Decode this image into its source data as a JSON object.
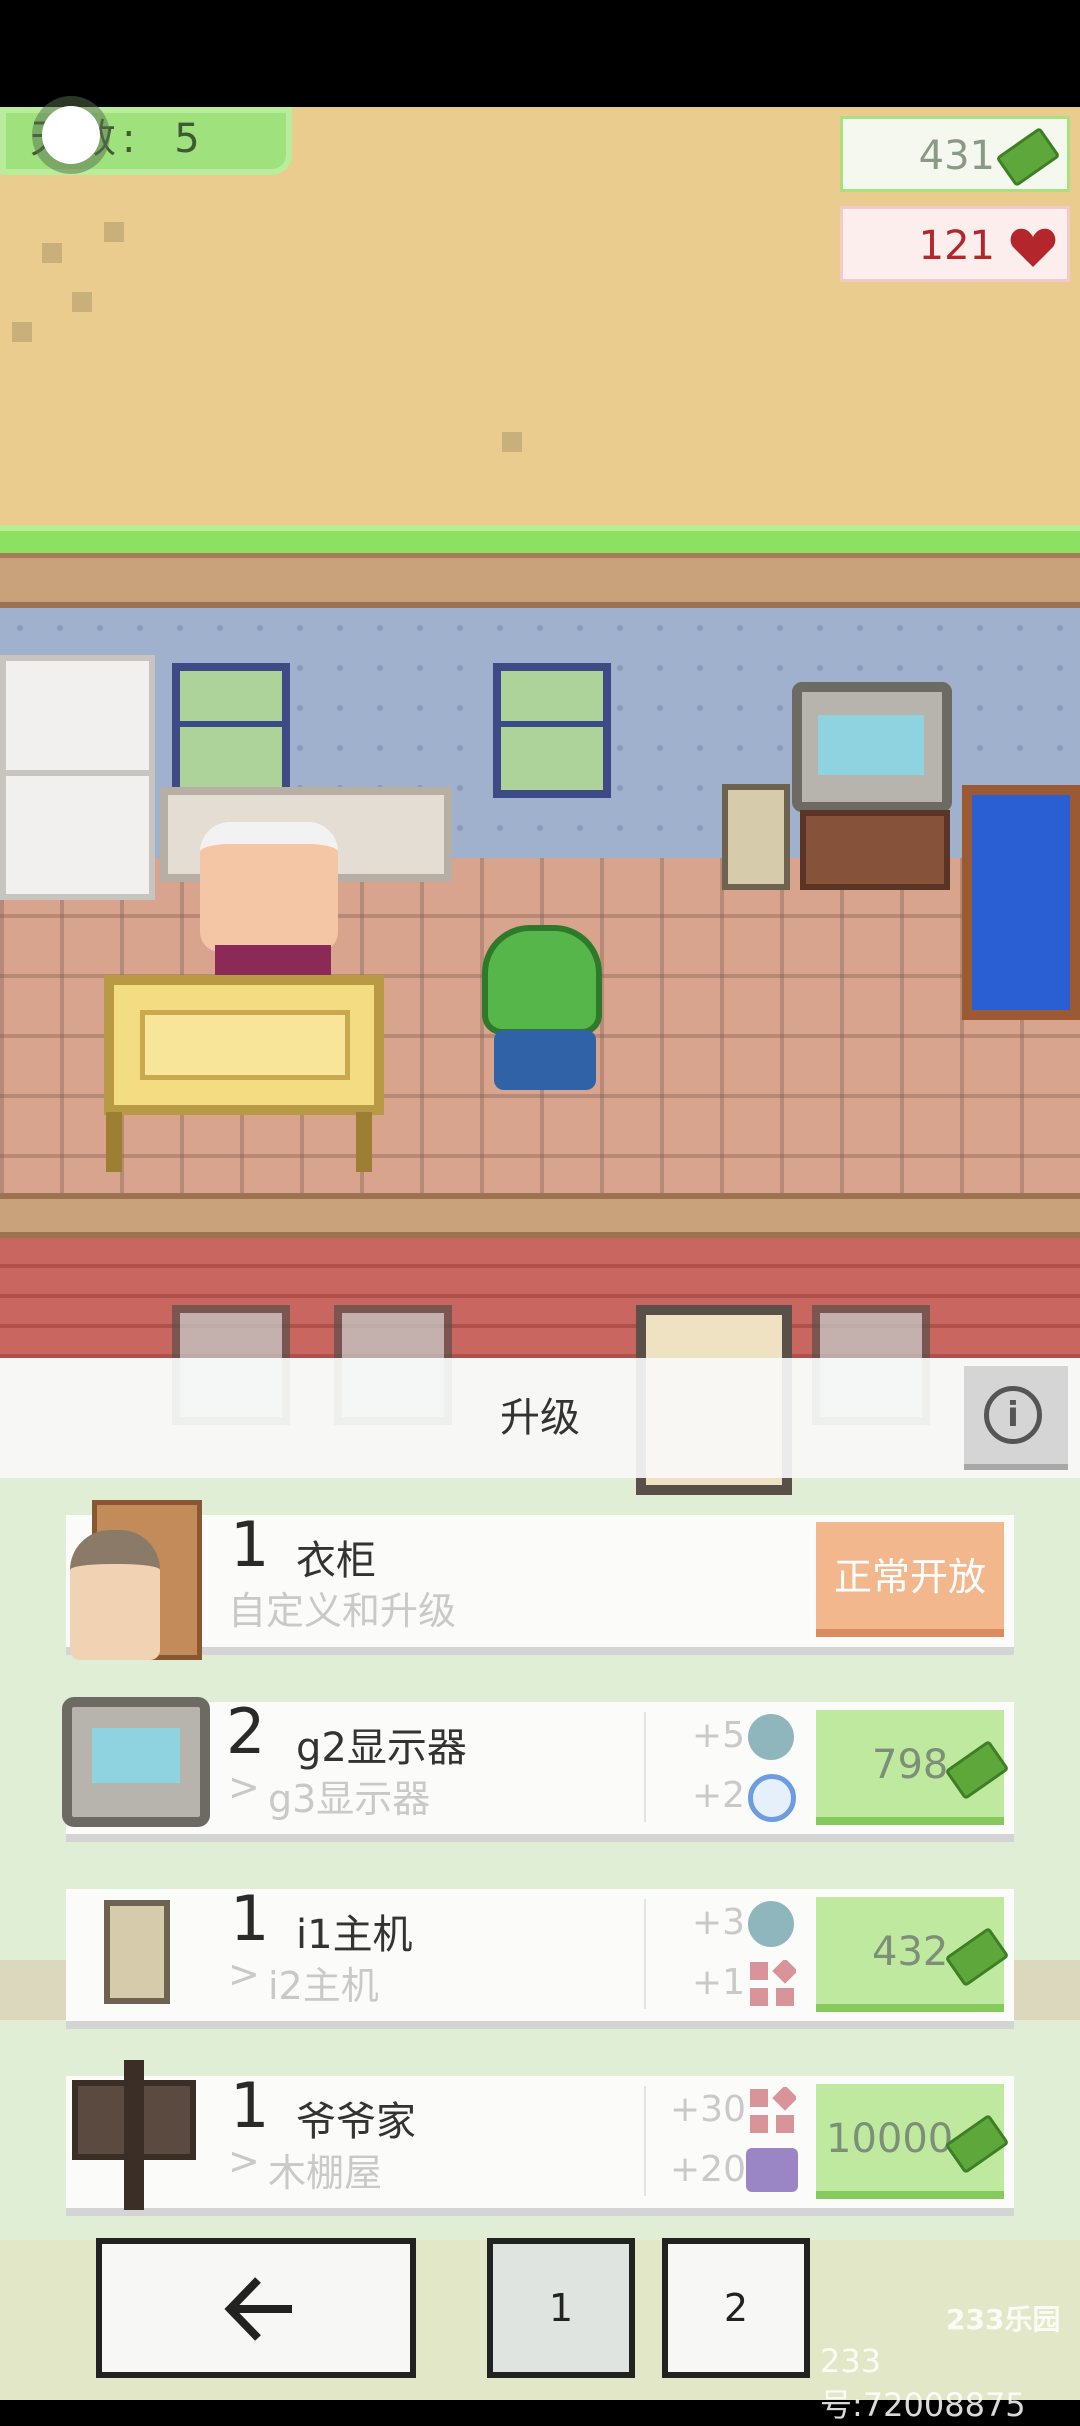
{
  "hud": {
    "day_label": "天数:",
    "day_value": "5",
    "money": "431",
    "hearts": "121"
  },
  "panel": {
    "title": "升级",
    "info_icon": "info-icon"
  },
  "cards": [
    {
      "level": "1",
      "name": "衣柜",
      "sub": "自定义和升级",
      "action_label": "正常开放"
    },
    {
      "level": "2",
      "name": "g2显示器",
      "next": "g3显示器",
      "bonus1": "+5",
      "bonus1_icon": "gear-icon",
      "bonus2": "+2",
      "bonus2_icon": "face-icon",
      "price": "798"
    },
    {
      "level": "1",
      "name": "i1主机",
      "next": "i2主机",
      "bonus1": "+3",
      "bonus1_icon": "gear-icon",
      "bonus2": "+1",
      "bonus2_icon": "blocks-icon",
      "price": "432"
    },
    {
      "level": "1",
      "name": "爷爷家",
      "next": "木棚屋",
      "bonus1": "+30",
      "bonus1_icon": "blocks-icon",
      "bonus2": "+20",
      "bonus2_icon": "chat-icon",
      "price": "10000"
    }
  ],
  "nav": {
    "back_icon": "arrow-left-icon",
    "page1": "1",
    "page2": "2"
  },
  "watermark": {
    "logo": "233乐园",
    "id_text": "233号:72008875"
  },
  "colors": {
    "grass": "#9fe27d",
    "price_button": "#bfe99f",
    "open_button": "#f3b78e",
    "heart": "#b3262c"
  }
}
